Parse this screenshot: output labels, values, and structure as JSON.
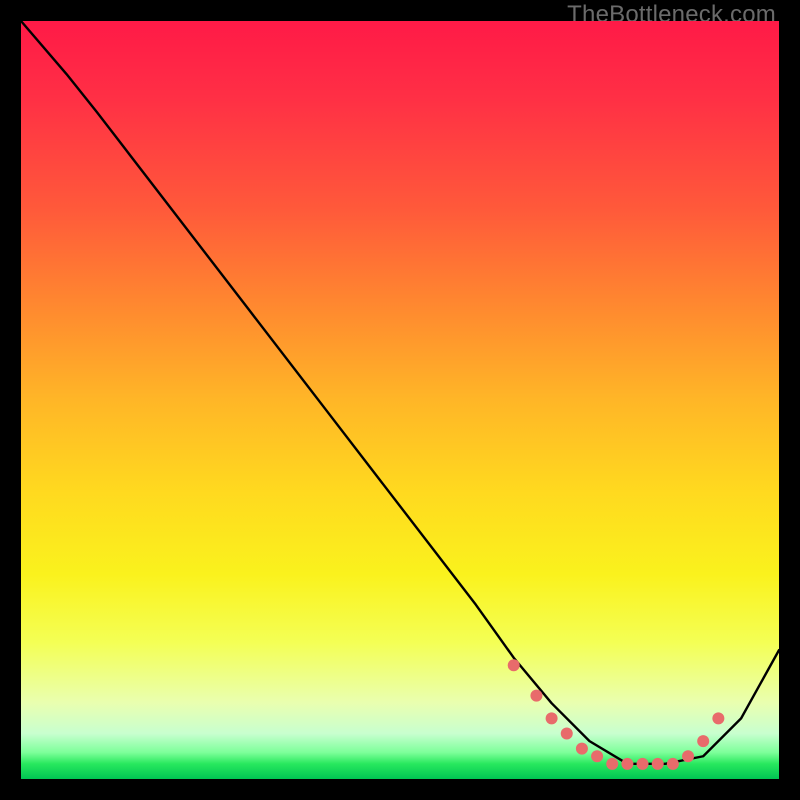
{
  "attribution": "TheBottleneck.com",
  "chart_data": {
    "type": "line",
    "title": "",
    "xlabel": "",
    "ylabel": "",
    "xlim": [
      0,
      100
    ],
    "ylim": [
      0,
      100
    ],
    "series": [
      {
        "name": "curve",
        "color": "#000000",
        "x": [
          0,
          6,
          10,
          20,
          30,
          40,
          50,
          60,
          65,
          70,
          75,
          80,
          85,
          90,
          95,
          100
        ],
        "y": [
          100,
          93,
          88,
          75,
          62,
          49,
          36,
          23,
          16,
          10,
          5,
          2,
          2,
          3,
          8,
          17
        ]
      }
    ],
    "markers": {
      "name": "dots",
      "color": "#e86b6b",
      "radius": 6,
      "x": [
        65,
        68,
        70,
        72,
        74,
        76,
        78,
        80,
        82,
        84,
        86,
        88,
        90,
        92
      ],
      "y": [
        15,
        11,
        8,
        6,
        4,
        3,
        2,
        2,
        2,
        2,
        2,
        3,
        5,
        8
      ]
    }
  }
}
